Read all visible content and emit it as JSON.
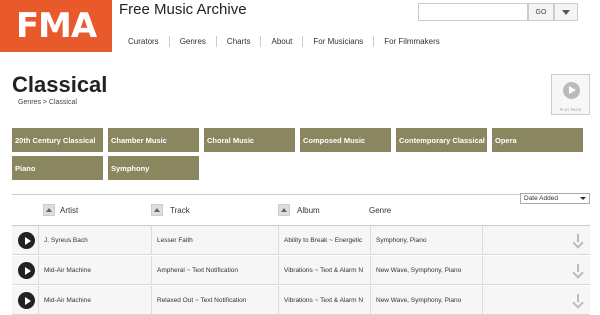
{
  "header": {
    "logo_text": "FMA",
    "site_title": "Free Music Archive",
    "nav": [
      "Curators",
      "Genres",
      "Charts",
      "About",
      "For Musicians",
      "For Filmmakers"
    ],
    "search": {
      "value": "",
      "go_label": "GO"
    }
  },
  "page": {
    "title": "Classical",
    "breadcrumb": "Genres > Classical",
    "play_all_label": "PLAY PAGE"
  },
  "genres": [
    "20th Century Classical",
    "Chamber Music",
    "Choral Music",
    "Composed Music",
    "Contemporary Classical",
    "Opera",
    "Piano",
    "Symphony"
  ],
  "table": {
    "sort_value": "Date Added",
    "columns": {
      "artist": "Artist",
      "track": "Track",
      "album": "Album",
      "genre": "Genre"
    },
    "rows": [
      {
        "artist": "J. Syreus Bach",
        "track": "Lesser Faith",
        "album": "Ability to Break ~ Energetic",
        "genre": "Symphony, Piano"
      },
      {
        "artist": "Mid-Air Machine",
        "track": "Ampheral ~ Text Notification",
        "album": "Vibrations ~ Text & Alarm N",
        "genre": "New Wave, Symphony, Piano"
      },
      {
        "artist": "Mid-Air Machine",
        "track": "Relaxed Out ~ Text Notification",
        "album": "Vibrations ~ Text & Alarm N",
        "genre": "New Wave, Symphony, Piano"
      }
    ]
  },
  "colors": {
    "logo_bg": "#e8592c",
    "tile_bg": "#8a8660"
  }
}
